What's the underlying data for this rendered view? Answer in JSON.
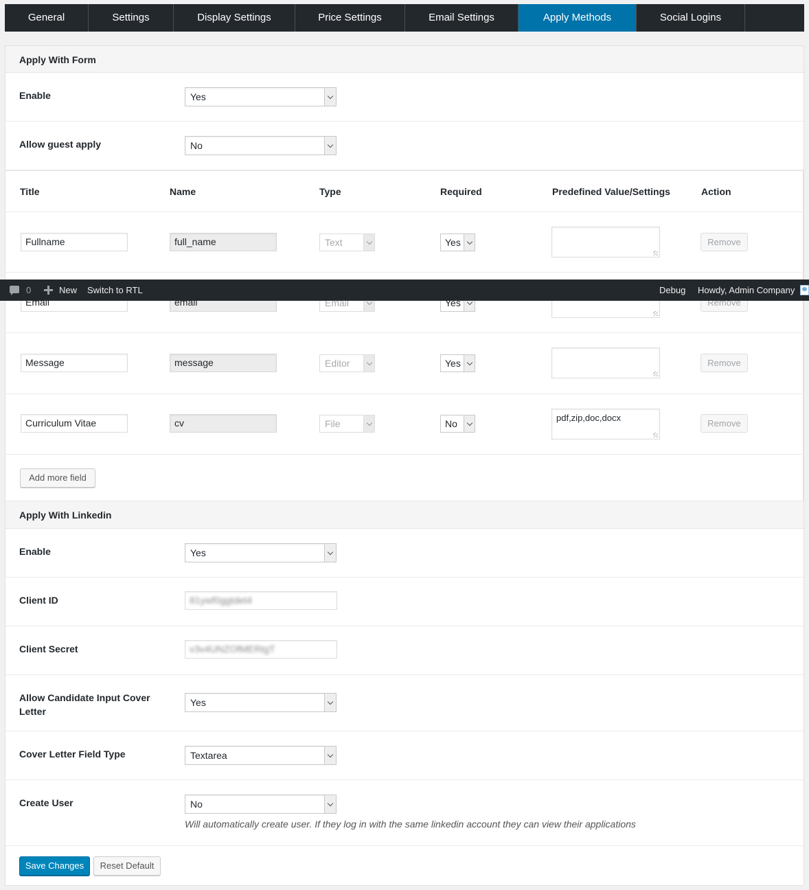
{
  "tabs": [
    {
      "label": "General",
      "active": false
    },
    {
      "label": "Settings",
      "active": false
    },
    {
      "label": "Display Settings",
      "active": false
    },
    {
      "label": "Price Settings",
      "active": false
    },
    {
      "label": "Email Settings",
      "active": false
    },
    {
      "label": "Apply Methods",
      "active": true
    },
    {
      "label": "Social Logins",
      "active": false
    }
  ],
  "apply_form": {
    "heading": "Apply With Form",
    "enable": {
      "label": "Enable",
      "value": "Yes"
    },
    "guest": {
      "label": "Allow guest apply",
      "value": "No"
    },
    "table": {
      "headers": {
        "title": "Title",
        "name": "Name",
        "type": "Type",
        "required": "Required",
        "predefined": "Predefined Value/Settings",
        "action": "Action"
      },
      "rows": [
        {
          "title": "Fullname",
          "name": "full_name",
          "type": "Text",
          "required": "Yes",
          "predefined": "",
          "action": "Remove"
        },
        {
          "title": "Email",
          "name": "email",
          "type": "Email",
          "required": "Yes",
          "predefined": "",
          "action": "Remove"
        },
        {
          "title": "Message",
          "name": "message",
          "type": "Editor",
          "required": "Yes",
          "predefined": "",
          "action": "Remove"
        },
        {
          "title": "Curriculum Vitae",
          "name": "cv",
          "type": "File",
          "required": "No",
          "predefined": "pdf,zip,doc,docx",
          "action": "Remove"
        }
      ],
      "add_button": "Add more field"
    }
  },
  "apply_linkedin": {
    "heading": "Apply With Linkedin",
    "enable": {
      "label": "Enable",
      "value": "Yes"
    },
    "client_id": {
      "label": "Client ID",
      "value": "81ywf0ggtdet4"
    },
    "client_secret": {
      "label": "Client Secret",
      "value": "v3v4UNZOfMERtgT"
    },
    "cover_letter": {
      "label": "Allow Candidate Input Cover Letter",
      "value": "Yes"
    },
    "cover_type": {
      "label": "Cover Letter Field Type",
      "value": "Textarea"
    },
    "create_user": {
      "label": "Create User",
      "value": "No",
      "hint": "Will automatically create user. If they log in with the same linkedin account they can view their applications"
    }
  },
  "buttons": {
    "save": "Save Changes",
    "reset": "Reset Default"
  },
  "adminbar": {
    "comments": "0",
    "new": "New",
    "rtl": "Switch to RTL",
    "debug": "Debug",
    "howdy": "Howdy, Admin Company"
  }
}
